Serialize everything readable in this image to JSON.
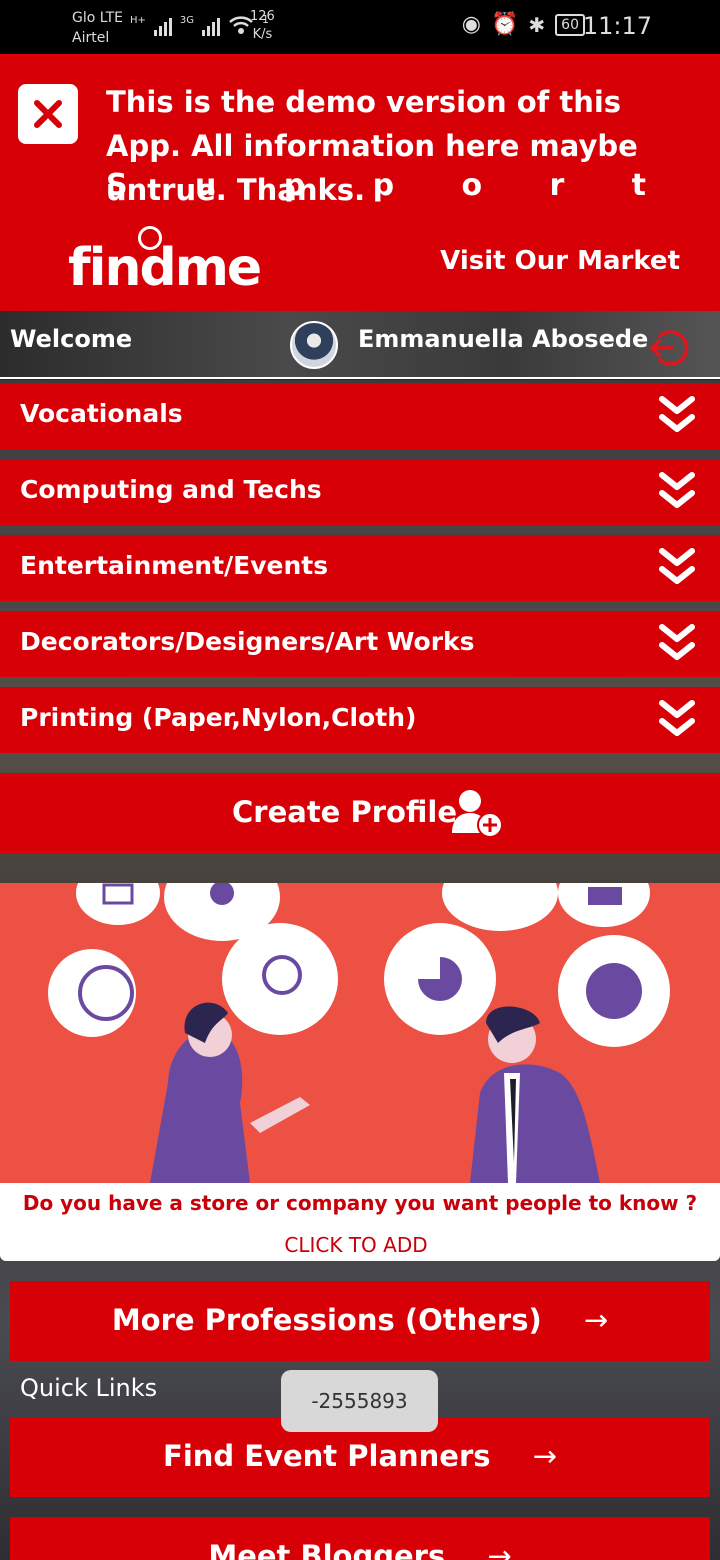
{
  "status_bar": {
    "carrier1": "Glo LTE",
    "carrier2": "Airtel",
    "net1": "H+",
    "net2": "3G",
    "speed_value": "126",
    "speed_unit": "K/s",
    "wifi_count": "1",
    "battery": "60",
    "time": "11:17"
  },
  "banner": {
    "demo_text": "This is the demo version of this App. All information here maybe untrue. Thanks.",
    "support_letters": [
      "S",
      "u",
      "p",
      "p",
      "o",
      "r",
      "t"
    ],
    "logo_text": "findme",
    "market_link": "Visit Our Market"
  },
  "welcome": {
    "label": "Welcome",
    "user_name": "Emmanuella Abosede"
  },
  "categories": [
    {
      "label": "Vocationals"
    },
    {
      "label": "Computing and Techs"
    },
    {
      "label": "Entertainment/Events"
    },
    {
      "label": "Decorators/Designers/Art Works"
    },
    {
      "label": "Printing (Paper,Nylon,Cloth)"
    }
  ],
  "create_profile": {
    "label": "Create Profile"
  },
  "store_promo": {
    "question": "Do you have a store or company you want people to know ?",
    "cta": "CLICK TO ADD"
  },
  "buttons": {
    "more_professions": "More Professions (Others)",
    "find_event_planners": "Find Event Planners",
    "meet_bloggers": "Meet Bloggers",
    "arrow": "→"
  },
  "quick_links": {
    "label": "Quick Links"
  },
  "toast": {
    "text": "-2555893"
  },
  "colors": {
    "brand_red": "#d70007",
    "illustration_bg": "#ec5143",
    "promo_text": "#c8000a"
  }
}
